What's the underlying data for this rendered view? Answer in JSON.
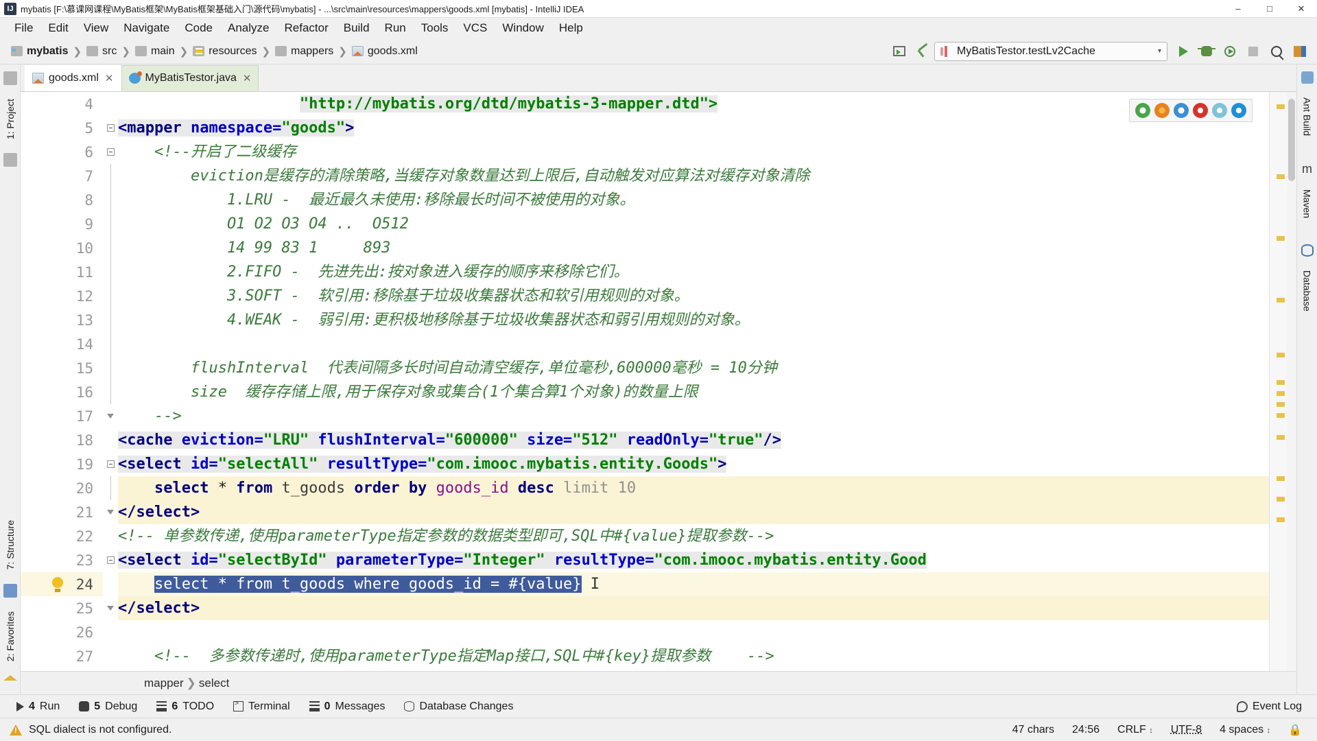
{
  "window": {
    "title": "mybatis [F:\\慕课网课程\\MyBatis框架\\MyBatis框架基础入门\\源代码\\mybatis] - ...\\src\\main\\resources\\mappers\\goods.xml [mybatis] - IntelliJ IDEA",
    "app_icon": "IJ",
    "minimize": "–",
    "maximize": "□",
    "close": "✕"
  },
  "menu": [
    "File",
    "Edit",
    "View",
    "Navigate",
    "Code",
    "Analyze",
    "Refactor",
    "Build",
    "Run",
    "Tools",
    "VCS",
    "Window",
    "Help"
  ],
  "breadcrumbs": [
    {
      "label": "mybatis",
      "icon": "module-folder-icon"
    },
    {
      "label": "src",
      "icon": "folder-icon"
    },
    {
      "label": "main",
      "icon": "folder-icon"
    },
    {
      "label": "resources",
      "icon": "resources-folder-icon"
    },
    {
      "label": "mappers",
      "icon": "folder-icon"
    },
    {
      "label": "goods.xml",
      "icon": "xml-file-icon"
    }
  ],
  "toolbar": {
    "run_config": "MyBatisTestor.testLv2Cache",
    "run_config_caret": "▾",
    "icons": [
      "project-window-icon",
      "build-hammer-icon",
      "run-icon",
      "debug-icon",
      "run-with-coverage-icon",
      "stop-icon",
      "search-everywhere-icon",
      "layout-icon"
    ]
  },
  "editor_tabs": [
    {
      "label": "goods.xml",
      "icon": "xml-file-icon",
      "active": false,
      "close": "✕"
    },
    {
      "label": "MyBatisTestor.java",
      "icon": "java-file-icon",
      "active": true,
      "close": "✕"
    }
  ],
  "left_tool_tabs": [
    {
      "label": "1: Project",
      "icon": "project-icon"
    },
    {
      "label": "7: Structure",
      "icon": "structure-icon"
    },
    {
      "label": "2: Favorites",
      "icon": "favorites-icon"
    }
  ],
  "right_tool_tabs": [
    {
      "label": "Ant Build",
      "icon": "ant-icon"
    },
    {
      "label": "Maven",
      "icon": "maven-icon"
    },
    {
      "label": "Database",
      "icon": "database-icon"
    }
  ],
  "browser_popup": {
    "icons": [
      "chrome-icon",
      "firefox-icon",
      "safari-icon",
      "opera-icon",
      "explorer-icon",
      "edge-icon"
    ],
    "colors": [
      "#4aa54a",
      "#e8811e",
      "#3b8fd4",
      "#d6322c",
      "#7fc3d8",
      "#1f8fd6"
    ]
  },
  "code": {
    "first_line_number": 4,
    "current_line": 24,
    "lines": [
      {
        "n": 4,
        "fold": "none",
        "style": "plain",
        "segments": [
          {
            "t": "                    ",
            "c": "tok-plain"
          },
          {
            "t": "\"http://mybatis.org/dtd/mybatis-3-mapper.dtd\">",
            "c": "tok-val",
            "bg": true
          }
        ]
      },
      {
        "n": 5,
        "fold": "minus",
        "style": "plain",
        "segments": [
          {
            "t": "<mapper ",
            "c": "tok-tag",
            "bg": true
          },
          {
            "t": "namespace=",
            "c": "tok-attr",
            "bg": true
          },
          {
            "t": "\"goods\"",
            "c": "tok-val",
            "bg": true
          },
          {
            "t": ">",
            "c": "tok-tag",
            "bg": true
          }
        ]
      },
      {
        "n": 6,
        "fold": "minus",
        "style": "plain",
        "segments": [
          {
            "t": "    <!--开启了二级缓存",
            "c": "tok-cmt"
          }
        ]
      },
      {
        "n": 7,
        "fold": "line",
        "style": "plain",
        "segments": [
          {
            "t": "        eviction是缓存的清除策略,当缓存对象数量达到上限后,自动触发对应算法对缓存对象清除",
            "c": "tok-cmt"
          }
        ]
      },
      {
        "n": 8,
        "fold": "line",
        "style": "plain",
        "segments": [
          {
            "t": "            1.LRU -  最近最久未使用:移除最长时间不被使用的对象。",
            "c": "tok-cmt"
          }
        ]
      },
      {
        "n": 9,
        "fold": "line",
        "style": "plain",
        "segments": [
          {
            "t": "            O1 O2 O3 O4 ..  O512",
            "c": "tok-cmt"
          }
        ]
      },
      {
        "n": 10,
        "fold": "line",
        "style": "plain",
        "segments": [
          {
            "t": "            14 99 83 1     893",
            "c": "tok-cmt"
          }
        ]
      },
      {
        "n": 11,
        "fold": "line",
        "style": "plain",
        "segments": [
          {
            "t": "            2.FIFO -  先进先出:按对象进入缓存的顺序来移除它们。",
            "c": "tok-cmt"
          }
        ]
      },
      {
        "n": 12,
        "fold": "line",
        "style": "plain",
        "segments": [
          {
            "t": "            3.SOFT -  软引用:移除基于垃圾收集器状态和软引用规则的对象。",
            "c": "tok-cmt"
          }
        ]
      },
      {
        "n": 13,
        "fold": "line",
        "style": "plain",
        "segments": [
          {
            "t": "            4.WEAK -  弱引用:更积极地移除基于垃圾收集器状态和弱引用规则的对象。",
            "c": "tok-cmt"
          }
        ]
      },
      {
        "n": 14,
        "fold": "line",
        "style": "plain",
        "segments": [
          {
            "t": "",
            "c": "tok-cmt"
          }
        ]
      },
      {
        "n": 15,
        "fold": "line",
        "style": "plain",
        "segments": [
          {
            "t": "        flushInterval  代表间隔多长时间自动清空缓存,单位毫秒,600000毫秒 = 10分钟",
            "c": "tok-cmt"
          }
        ]
      },
      {
        "n": 16,
        "fold": "line",
        "style": "plain",
        "segments": [
          {
            "t": "        size  缓存存储上限,用于保存对象或集合(1个集合算1个对象)的数量上限",
            "c": "tok-cmt"
          }
        ]
      },
      {
        "n": 17,
        "fold": "arrow",
        "style": "plain",
        "segments": [
          {
            "t": "    -->",
            "c": "tok-cmt"
          }
        ]
      },
      {
        "n": 18,
        "fold": "none",
        "style": "plain",
        "segments": [
          {
            "t": "<cache ",
            "c": "tok-tag",
            "bg": true
          },
          {
            "t": "eviction=",
            "c": "tok-attr",
            "bg": true
          },
          {
            "t": "\"LRU\"",
            "c": "tok-val",
            "bg": true
          },
          {
            "t": " ",
            "c": "tok-plain",
            "bg": true
          },
          {
            "t": "flushInterval=",
            "c": "tok-attr",
            "bg": true
          },
          {
            "t": "\"600000\"",
            "c": "tok-val",
            "bg": true
          },
          {
            "t": " ",
            "c": "tok-plain",
            "bg": true
          },
          {
            "t": "size=",
            "c": "tok-attr",
            "bg": true
          },
          {
            "t": "\"512\"",
            "c": "tok-val",
            "bg": true
          },
          {
            "t": " ",
            "c": "tok-plain",
            "bg": true
          },
          {
            "t": "readOnly=",
            "c": "tok-attr",
            "bg": true
          },
          {
            "t": "\"true\"",
            "c": "tok-val",
            "bg": true
          },
          {
            "t": "/>",
            "c": "tok-tag",
            "bg": true
          }
        ]
      },
      {
        "n": 19,
        "fold": "minus",
        "style": "plain",
        "segments": [
          {
            "t": "<select ",
            "c": "tok-tag",
            "bg": true
          },
          {
            "t": "id=",
            "c": "tok-attr",
            "bg": true
          },
          {
            "t": "\"selectAll\"",
            "c": "tok-val",
            "bg": true
          },
          {
            "t": " ",
            "c": "tok-plain",
            "bg": true
          },
          {
            "t": "resultType=",
            "c": "tok-attr",
            "bg": true
          },
          {
            "t": "\"com.imooc.mybatis.entity.Goods\"",
            "c": "tok-val",
            "bg": true
          },
          {
            "t": ">",
            "c": "tok-tag",
            "bg": true
          }
        ]
      },
      {
        "n": 20,
        "fold": "line",
        "style": "hl",
        "segments": [
          {
            "t": "    ",
            "c": "tok-plain"
          },
          {
            "t": "select",
            "c": "tok-kw"
          },
          {
            "t": " * ",
            "c": "tok-plain"
          },
          {
            "t": "from",
            "c": "tok-kw"
          },
          {
            "t": " t_goods ",
            "c": "tok-ident"
          },
          {
            "t": "order by",
            "c": "tok-kw"
          },
          {
            "t": " ",
            "c": "tok-plain"
          },
          {
            "t": "goods_id",
            "c": "tok-field"
          },
          {
            "t": " ",
            "c": "tok-plain"
          },
          {
            "t": "desc",
            "c": "tok-kw"
          },
          {
            "t": " ",
            "c": "tok-plain"
          },
          {
            "t": "limit",
            "c": "tok-num"
          },
          {
            "t": " ",
            "c": "tok-plain"
          },
          {
            "t": "10",
            "c": "tok-num"
          }
        ]
      },
      {
        "n": 21,
        "fold": "arrow",
        "style": "hl",
        "segments": [
          {
            "t": "</select>",
            "c": "tok-tag"
          }
        ]
      },
      {
        "n": 22,
        "fold": "none",
        "style": "plain",
        "segments": [
          {
            "t": "<!-- 单参数传递,使用parameterType指定参数的数据类型即可,SQL中#{value}提取参数-->",
            "c": "tok-cmt"
          }
        ]
      },
      {
        "n": 23,
        "fold": "minus",
        "style": "plain",
        "segments": [
          {
            "t": "<select ",
            "c": "tok-tag",
            "bg": true
          },
          {
            "t": "id=",
            "c": "tok-attr",
            "bg": true
          },
          {
            "t": "\"selectById\"",
            "c": "tok-val",
            "bg": true
          },
          {
            "t": " ",
            "c": "tok-plain",
            "bg": true
          },
          {
            "t": "parameterType=",
            "c": "tok-attr",
            "bg": true
          },
          {
            "t": "\"Integer\"",
            "c": "tok-val",
            "bg": true
          },
          {
            "t": " ",
            "c": "tok-plain",
            "bg": true
          },
          {
            "t": "resultType=",
            "c": "tok-attr",
            "bg": true
          },
          {
            "t": "\"com.imooc.mybatis.entity.Good",
            "c": "tok-val",
            "bg": true
          }
        ]
      },
      {
        "n": 24,
        "fold": "none",
        "style": "cur",
        "bulb": true,
        "segments": [
          {
            "t": "    ",
            "c": "tok-plain"
          },
          {
            "t": "select * from t_goods where goods_id = #{value}",
            "c": "tok-plain",
            "selected": true
          }
        ]
      },
      {
        "n": 25,
        "fold": "arrow",
        "style": "hl",
        "segments": [
          {
            "t": "</select>",
            "c": "tok-tag"
          }
        ]
      },
      {
        "n": 26,
        "fold": "none",
        "style": "plain",
        "segments": [
          {
            "t": "",
            "c": "tok-plain"
          }
        ]
      },
      {
        "n": 27,
        "fold": "none",
        "style": "plain",
        "segments": [
          {
            "t": "    <!--  多参数传递时,使用parameterType指定Map接口,SQL中#{key}提取参数    -->",
            "c": "tok-cmt"
          }
        ]
      }
    ]
  },
  "editor_breadcrumbs": [
    {
      "label": "mapper"
    },
    {
      "label": "select"
    }
  ],
  "tool_windows": [
    {
      "num": "4",
      "label": "Run",
      "icon": "run-icon"
    },
    {
      "num": "5",
      "label": "Debug",
      "icon": "debug-icon"
    },
    {
      "num": "6",
      "label": "TODO",
      "icon": "todo-icon"
    },
    {
      "num": "",
      "label": "Terminal",
      "icon": "terminal-icon"
    },
    {
      "num": "0",
      "label": "Messages",
      "icon": "messages-icon"
    },
    {
      "num": "",
      "label": "Database Changes",
      "icon": "database-changes-icon"
    }
  ],
  "event_log": "Event Log",
  "status": {
    "message": "SQL dialect is not configured.",
    "chars": "47 chars",
    "caret": "24:56",
    "line_sep": "CRLF",
    "line_sep_caret": "↕",
    "encoding": "UTF-8",
    "indent": "4 spaces",
    "indent_caret": "↕",
    "lock_icon": "lock-icon"
  }
}
